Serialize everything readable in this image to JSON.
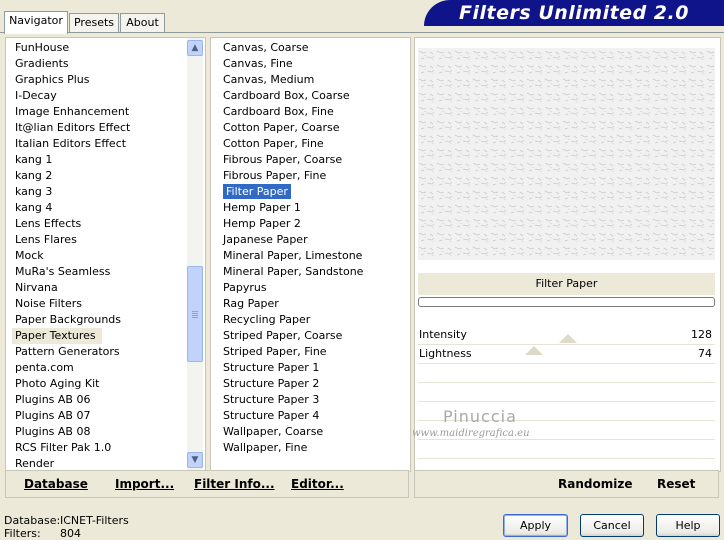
{
  "app": {
    "title": "Filters Unlimited 2.0"
  },
  "tabs": [
    {
      "label": "Navigator",
      "active": true
    },
    {
      "label": "Presets",
      "active": false
    },
    {
      "label": "About",
      "active": false
    }
  ],
  "categories": {
    "items": [
      "FunHouse",
      "Gradients",
      "Graphics Plus",
      "I-Decay",
      "Image Enhancement",
      "It@lian Editors Effect",
      "Italian Editors Effect",
      "kang 1",
      "kang 2",
      "kang 3",
      "kang 4",
      "Lens Effects",
      "Lens Flares",
      "Mock",
      "MuRa's Seamless",
      "Nirvana",
      "Noise Filters",
      "Paper Backgrounds",
      "Paper Textures",
      "Pattern Generators",
      "penta.com",
      "Photo Aging Kit",
      "Plugins AB 06",
      "Plugins AB 07",
      "Plugins AB 08",
      "RCS Filter Pak 1.0",
      "Render"
    ],
    "selected": "Paper Textures"
  },
  "filters": {
    "items": [
      "Canvas, Coarse",
      "Canvas, Fine",
      "Canvas, Medium",
      "Cardboard Box, Coarse",
      "Cardboard Box, Fine",
      "Cotton Paper, Coarse",
      "Cotton Paper, Fine",
      "Fibrous Paper, Coarse",
      "Fibrous Paper, Fine",
      "Filter Paper",
      "Hemp Paper 1",
      "Hemp Paper 2",
      "Japanese Paper",
      "Mineral Paper, Limestone",
      "Mineral Paper, Sandstone",
      "Papyrus",
      "Rag Paper",
      "Recycling Paper",
      "Striped Paper, Coarse",
      "Striped Paper, Fine",
      "Structure Paper 1",
      "Structure Paper 2",
      "Structure Paper 3",
      "Structure Paper 4",
      "Wallpaper, Coarse",
      "Wallpaper, Fine"
    ],
    "selected": "Filter Paper"
  },
  "preview": {
    "filter_name": "Filter Paper"
  },
  "params": [
    {
      "label": "Intensity",
      "value": "128",
      "level": 0.5
    },
    {
      "label": "Lightness",
      "value": "74",
      "level": 0.29
    }
  ],
  "toolbar": {
    "database": "Database",
    "import": "Import...",
    "filter_info": "Filter Info...",
    "editor": "Editor...",
    "randomize": "Randomize",
    "reset": "Reset"
  },
  "status": {
    "database_label": "Database:",
    "database_value": "ICNET-Filters",
    "filters_label": "Filters:",
    "filters_value": "804"
  },
  "buttons": {
    "apply": "Apply",
    "cancel": "Cancel",
    "help": "Help"
  },
  "watermark": {
    "name": "Pinuccia",
    "url": "www.maidiregrafica.eu"
  },
  "colors": {
    "banner": "#10148a",
    "selection": "#316ac5",
    "window": "#ece9d8"
  }
}
